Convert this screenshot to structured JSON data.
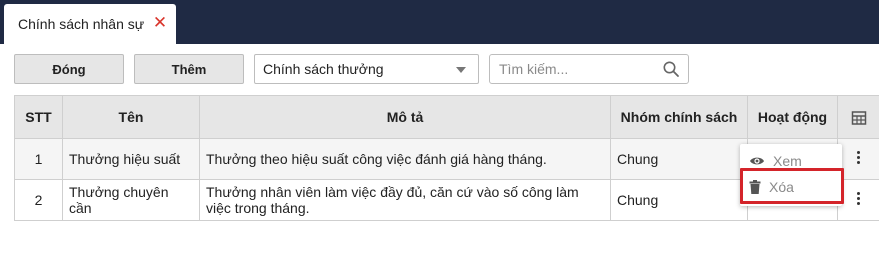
{
  "tab": {
    "title": "Chính sách nhân sự"
  },
  "toolbar": {
    "close_label": "Đóng",
    "add_label": "Thêm",
    "policy_select_value": "Chính sách thưởng",
    "search_placeholder": "Tìm kiếm..."
  },
  "table": {
    "headers": {
      "stt": "STT",
      "name": "Tên",
      "description": "Mô tả",
      "group": "Nhóm chính sách",
      "actions": "Hoạt động"
    },
    "rows": [
      {
        "stt": "1",
        "name": "Thưởng hiệu suất",
        "description": "Thưởng theo hiệu suất công việc đánh giá hàng tháng.",
        "group": "Chung"
      },
      {
        "stt": "2",
        "name": "Thưởng chuyên cần",
        "description": "Thưởng nhân viên làm việc đầy đủ, căn cứ vào số công làm việc trong tháng.",
        "group": "Chung"
      }
    ]
  },
  "action_menu": {
    "view_label": "Xem",
    "delete_label": "Xóa"
  },
  "colors": {
    "topbar": "#1f2a44",
    "close_icon": "#d9342b",
    "highlight": "#d4242a"
  }
}
